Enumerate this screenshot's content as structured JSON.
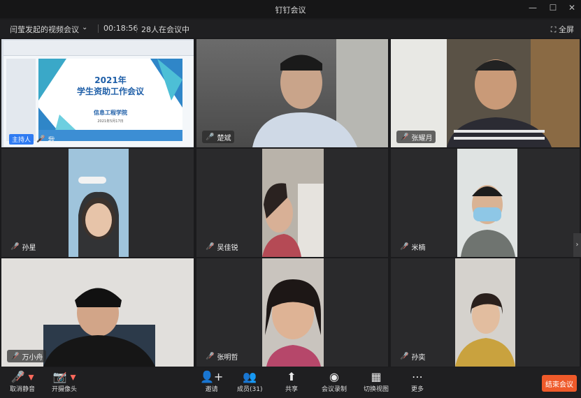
{
  "window": {
    "title": "钉钉会议",
    "minimize": "—",
    "maximize": "☐",
    "close": "✕"
  },
  "meeting": {
    "name": "闫莹发起的视频会议",
    "duration": "00:18:56",
    "attendees": "28人在会议中",
    "fullscreen_label": "全屏"
  },
  "slide": {
    "line1": "2021年",
    "line2": "学生资助工作会议",
    "line3": "信息工程学院",
    "line4": "2021年5月17日"
  },
  "participants": [
    {
      "name": "我",
      "host_label": "主持人",
      "muted": true
    },
    {
      "name": "楚斌",
      "muted": false
    },
    {
      "name": "张耀月",
      "muted": true
    },
    {
      "name": "孙星",
      "muted": true
    },
    {
      "name": "吴佳锐",
      "muted": true
    },
    {
      "name": "米楠",
      "muted": true
    },
    {
      "name": "万小舟",
      "muted": true
    },
    {
      "name": "张明哲",
      "muted": true
    },
    {
      "name": "孙奕",
      "muted": true
    }
  ],
  "toolbar": {
    "unmute": "取消静音",
    "camera": "开摄像头",
    "invite": "邀请",
    "members": "成员(31)",
    "share": "共享",
    "record": "会议录制",
    "switch_view": "切换视图",
    "more": "更多",
    "end": "结束会议"
  },
  "colors": {
    "accent": "#2f7bf2",
    "end_button": "#ef5a2a",
    "muted_icon": "#ff6a5c"
  }
}
